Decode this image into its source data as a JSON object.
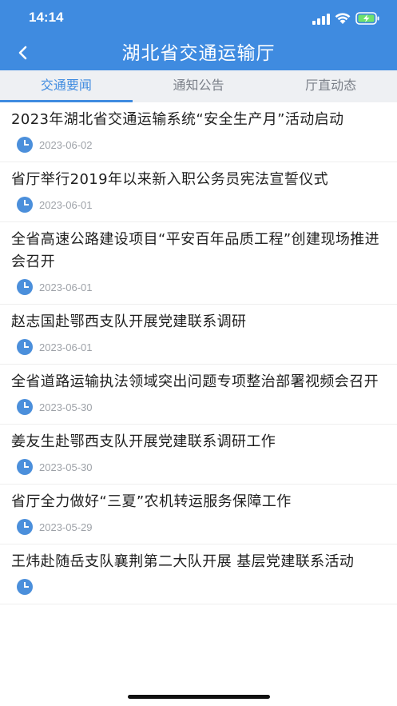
{
  "status": {
    "time": "14:14"
  },
  "nav": {
    "title": "湖北省交通运输厅",
    "back_icon": "chevron-left-icon"
  },
  "tabs": [
    {
      "label": "交通要闻",
      "active": true
    },
    {
      "label": "通知公告",
      "active": false
    },
    {
      "label": "厅直动态",
      "active": false
    }
  ],
  "news": [
    {
      "title": "2023年湖北省交通运输系统“安全生产月”活动启动",
      "date": "2023-06-02"
    },
    {
      "title": "省厅举行2019年以来新入职公务员宪法宣誓仪式",
      "date": "2023-06-01"
    },
    {
      "title": "全省高速公路建设项目“平安百年品质工程”创建现场推进会召开",
      "date": "2023-06-01"
    },
    {
      "title": "赵志国赴鄂西支队开展党建联系调研",
      "date": "2023-06-01"
    },
    {
      "title": "全省道路运输执法领域突出问题专项整治部署视频会召开",
      "date": "2023-05-30"
    },
    {
      "title": "姜友生赴鄂西支队开展党建联系调研工作",
      "date": "2023-05-30"
    },
    {
      "title": "省厅全力做好“三夏”农机转运服务保障工作",
      "date": "2023-05-29"
    },
    {
      "title": "王炜赴随岳支队襄荆第二大队开展 基层党建联系活动",
      "date": ""
    }
  ],
  "colors": {
    "primary": "#3f8be0",
    "tab_bg": "#eef0f3",
    "date": "#9ea2a8"
  }
}
